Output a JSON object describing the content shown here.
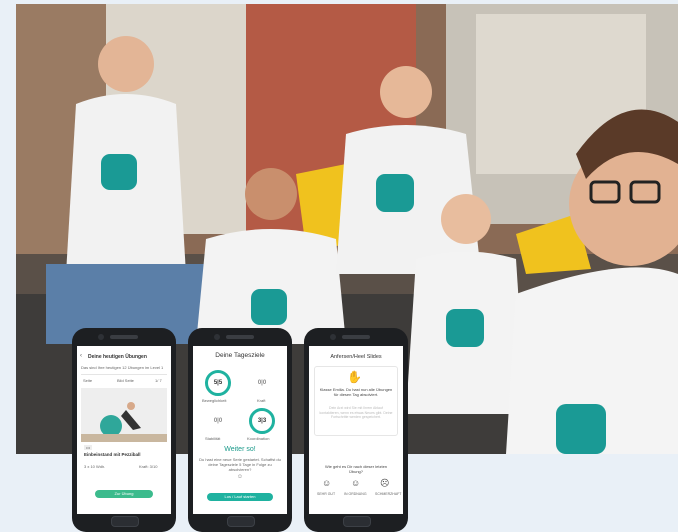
{
  "phone1": {
    "header_title": "Deine heutigen Übungen",
    "subtitle": "Das sind Ihre heutigen 12 Übungen im Level 1",
    "tabs": [
      "Seite",
      "Bild Seite",
      "1/ 7"
    ],
    "exercise_title": "Einbeinstand mit Pezziball",
    "stat_left": "3 x 10 Wdh.",
    "stat_right": "Kraft: 3/10",
    "cta_label": "Zur Übung"
  },
  "phone2": {
    "title": "Deine Tagesziele",
    "goals": [
      {
        "value": "5|5",
        "label": "Beweglichkeit"
      },
      {
        "value": "0|0",
        "label": "Kraft"
      },
      {
        "value": "0|0",
        "label": "Stabilität"
      },
      {
        "value": "3|3",
        "label": "Koordination"
      }
    ],
    "headline": "Weiter so!",
    "body": "Du hast eine neue Serie gestartet. Schaffst du deine Tagesziele 5 Tage in Folge zu absolvieren?",
    "cta_label": "Los / Lauf starten"
  },
  "phone3": {
    "title": "Anfersen/Heel Slides",
    "message": "Klasse Emilia. Du hast nun alle Übungen für diesen Tag absolviert.",
    "faded_text": "Dein Arzt wird Sie mit Ihrem Ablauf kontaktieren, wenn es etwas Neues gibt. Deine Fortschritte werden gespeichert.",
    "question": "Wie geht es Dir nach dieser letzten Übung?",
    "moods": [
      "SEHR GUT",
      "IN ORDNUNG",
      "SCHMERZHAFT"
    ]
  }
}
